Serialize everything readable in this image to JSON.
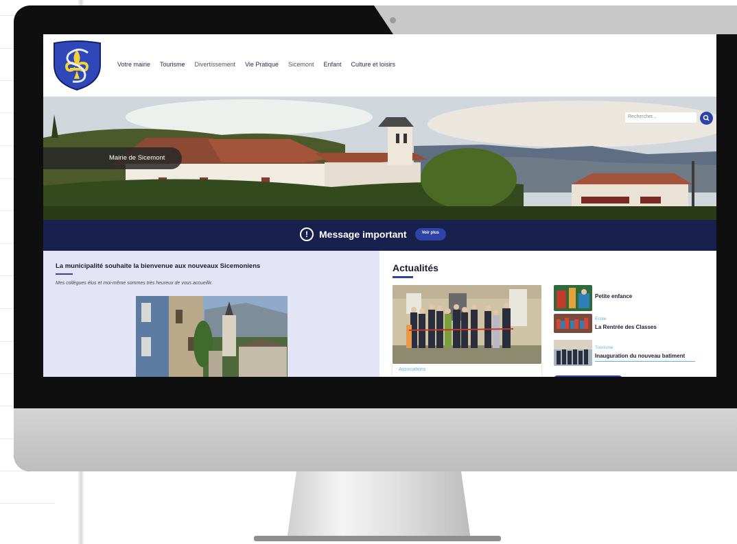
{
  "nav": {
    "items": [
      {
        "label": "Votre mairie"
      },
      {
        "label": "Tourisme"
      },
      {
        "label": "Divertissement"
      },
      {
        "label": "Vie Pratique"
      },
      {
        "label": "Sicemont"
      },
      {
        "label": "Enfant"
      },
      {
        "label": "Culture et loisirs"
      }
    ]
  },
  "hero": {
    "label": "Mairie de Sicemont",
    "search_placeholder": "Rechercher..."
  },
  "banner": {
    "message": "Message important",
    "button_label": "Voir plus",
    "icon": "exclamation-circle-icon"
  },
  "welcome": {
    "title": "La municipalité souhaite la bienvenue aux nouveaux Sicemoniens",
    "subtitle": "Mes collègues élus et moi-même sommes très heureux de vous accueillir."
  },
  "news": {
    "title": "Actualités",
    "featured_category": "Associations",
    "items": [
      {
        "category": "",
        "title": "Petite enfance"
      },
      {
        "category": "Ecole",
        "title": "La Rentrée des Classes"
      },
      {
        "category": "Tourisme",
        "title": "Inauguration du nouveau batiment"
      }
    ]
  },
  "colors": {
    "accent": "#2d43a8",
    "banner": "#18204e",
    "welcome_bg": "#e3e5f7",
    "category": "#56b7e6"
  }
}
